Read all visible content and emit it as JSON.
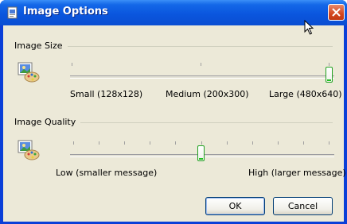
{
  "window": {
    "title": "Image Options"
  },
  "image_size": {
    "group_label": "Image Size",
    "slider": {
      "min_label": "Small (128x128)",
      "mid_label": "Medium (200x300)",
      "max_label": "Large (480x640)",
      "positions": 3,
      "selected_index": 2
    }
  },
  "image_quality": {
    "group_label": "Image Quality",
    "slider": {
      "min_label": "Low (smaller message)",
      "max_label": "High (larger message)",
      "positions": 11,
      "selected_index": 5
    }
  },
  "buttons": {
    "ok": "OK",
    "cancel": "Cancel"
  },
  "icons": {
    "app": "document-image-icon",
    "close": "close-icon",
    "picture": "picture-palette-icon"
  },
  "colors": {
    "titlebar": "#0a56de",
    "face": "#ece9d8",
    "slider_accent": "#21c121"
  }
}
